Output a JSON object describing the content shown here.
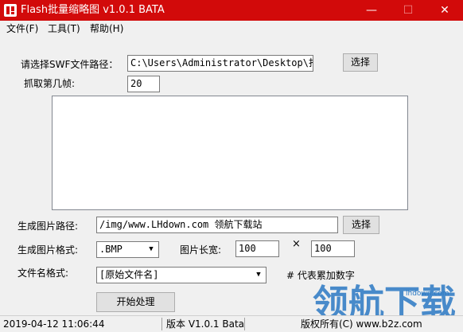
{
  "window": {
    "title": "Flash批量缩略图 v1.0.1 BATA",
    "minimize_glyph": "—",
    "maximize_glyph": "☐",
    "close_glyph": "✕",
    "titlebar_color": "#d20a0a"
  },
  "menu": [
    "文件(F)",
    "工具(T)",
    "帮助(H)"
  ],
  "form": {
    "swf_path_label": "请选择SWF文件路径：",
    "swf_path_value": "C:\\Users\\Administrator\\Desktop\\打",
    "browse_swf_label": "选择",
    "frame_label": "抓取第几帧:",
    "frame_value": "20",
    "output_path_label": "生成图片路径:",
    "output_path_value": "/img/www.LHdown.com  领航下载站",
    "browse_output_label": "选择",
    "format_label": "生成图片格式:",
    "format_value": ".BMP",
    "size_label": "图片长宽:",
    "width_value": "100",
    "times_glyph": "×",
    "height_value": "100",
    "filename_label": "文件名格式:",
    "filename_value": "[原始文件名]",
    "filename_hint": "# 代表累加数字",
    "start_button": "开始处理"
  },
  "status": {
    "datetime": "2019-04-12 11:06:44",
    "version": "版本 V1.0.1 Bata",
    "copyright": "版权所有(C) www.b2z.com"
  },
  "watermark": {
    "text": "领航下载",
    "url": "lhdown.com",
    "color": "#2b79c4"
  }
}
